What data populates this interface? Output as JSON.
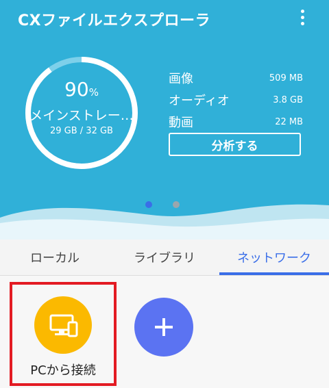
{
  "app": {
    "title": "CXファイルエクスプローラ"
  },
  "storage": {
    "percent": "90",
    "percent_sign": "%",
    "used_fraction": 0.9,
    "name": "メインストレー…",
    "size": "29 GB / 32 GB"
  },
  "stats": [
    {
      "label": "画像",
      "value": "509 MB"
    },
    {
      "label": "オーディオ",
      "value": "3.8 GB"
    },
    {
      "label": "動画",
      "value": "22 MB"
    }
  ],
  "analyze_label": "分析する",
  "pager": {
    "count": 2,
    "active_index": 0
  },
  "tabs": [
    {
      "label": "ローカル"
    },
    {
      "label": "ライブラリ"
    },
    {
      "label": "ネットワーク",
      "active": true
    }
  ],
  "network": {
    "connect_pc_label": "PCから接続",
    "connect_pc_icon": "desktop-phone-icon",
    "add_icon": "plus-icon"
  },
  "colors": {
    "header_bg": "#30b0d8",
    "accent": "#3a6ee8",
    "pc_button": "#fbb900",
    "add_button": "#5b73f2",
    "highlight_box": "#e31b23"
  }
}
